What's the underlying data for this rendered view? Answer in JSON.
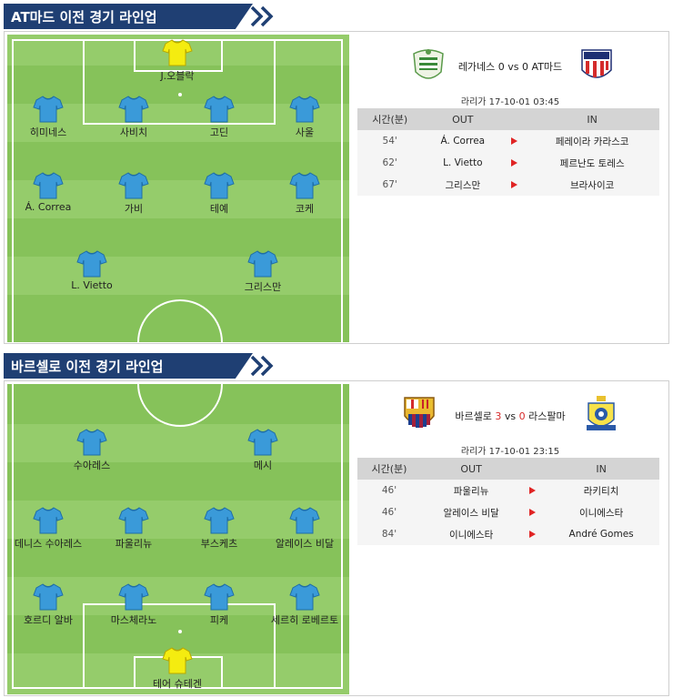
{
  "sections": [
    {
      "banner_title": "AT마드 이전 경기 라인업",
      "players": [
        {
          "name": "J.오블락",
          "kit": "yellow"
        },
        {
          "name": "히미네스",
          "kit": "blue"
        },
        {
          "name": "사비치",
          "kit": "blue"
        },
        {
          "name": "고딘",
          "kit": "blue"
        },
        {
          "name": "사울",
          "kit": "blue"
        },
        {
          "name": "Á. Correa",
          "kit": "blue"
        },
        {
          "name": "가비",
          "kit": "blue"
        },
        {
          "name": "테예",
          "kit": "blue"
        },
        {
          "name": "코케",
          "kit": "blue"
        },
        {
          "name": "L. Vietto",
          "kit": "blue"
        },
        {
          "name": "그리스만",
          "kit": "blue"
        }
      ],
      "match": {
        "home": "레가네스",
        "home_score": "0",
        "vs": "vs",
        "away_score": "0",
        "away": "AT마드",
        "league_date": "라리가 17-10-01 03:45",
        "score_highlight": false
      },
      "subs_header": {
        "time": "시간(분)",
        "out": "OUT",
        "in": "IN"
      },
      "subs": [
        {
          "time": "54'",
          "out": "Á. Correa",
          "in": "페레이라 카라스코"
        },
        {
          "time": "62'",
          "out": "L. Vietto",
          "in": "페르난도 토레스"
        },
        {
          "time": "67'",
          "out": "그리스만",
          "in": "브라사이코"
        }
      ]
    },
    {
      "banner_title": "바르셀로 이전 경기 라인업",
      "players": [
        {
          "name": "수아레스",
          "kit": "blue"
        },
        {
          "name": "메시",
          "kit": "blue"
        },
        {
          "name": "데니스 수아레스",
          "kit": "blue"
        },
        {
          "name": "파울리뉴",
          "kit": "blue"
        },
        {
          "name": "부스케츠",
          "kit": "blue"
        },
        {
          "name": "알레이스 비달",
          "kit": "blue"
        },
        {
          "name": "호르디 알바",
          "kit": "blue"
        },
        {
          "name": "마스체라노",
          "kit": "blue"
        },
        {
          "name": "피케",
          "kit": "blue"
        },
        {
          "name": "세르히 로베르토",
          "kit": "blue"
        },
        {
          "name": "테어 슈테겐",
          "kit": "yellow"
        }
      ],
      "match": {
        "home": "바르셀로",
        "home_score": "3",
        "vs": "vs",
        "away_score": "0",
        "away": "라스팔마",
        "league_date": "라리가 17-10-01 23:15",
        "score_highlight": true
      },
      "subs_header": {
        "time": "시간(분)",
        "out": "OUT",
        "in": "IN"
      },
      "subs": [
        {
          "time": "46'",
          "out": "파울리뉴",
          "in": "라키티치"
        },
        {
          "time": "46'",
          "out": "알레이스 비달",
          "in": "이니에스타"
        },
        {
          "time": "84'",
          "out": "이니에스타",
          "in": "André Gomes"
        }
      ]
    }
  ],
  "colors": {
    "banner": "#1f3f73",
    "grass_light": "#95cc6b",
    "grass_dark": "#86c25a",
    "jersey_blue": "#3a9ad9",
    "jersey_yellow": "#f4ec10",
    "arrow_red": "#e02424",
    "score_red": "#d62a2a"
  },
  "icons": {
    "jersey": "shirt-icon",
    "arrow": "sub-arrow-icon",
    "chevrons": "double-chevron-icon",
    "logos": [
      "leganes-crest",
      "atletico-crest",
      "barcelona-crest",
      "las-palmas-crest"
    ]
  }
}
